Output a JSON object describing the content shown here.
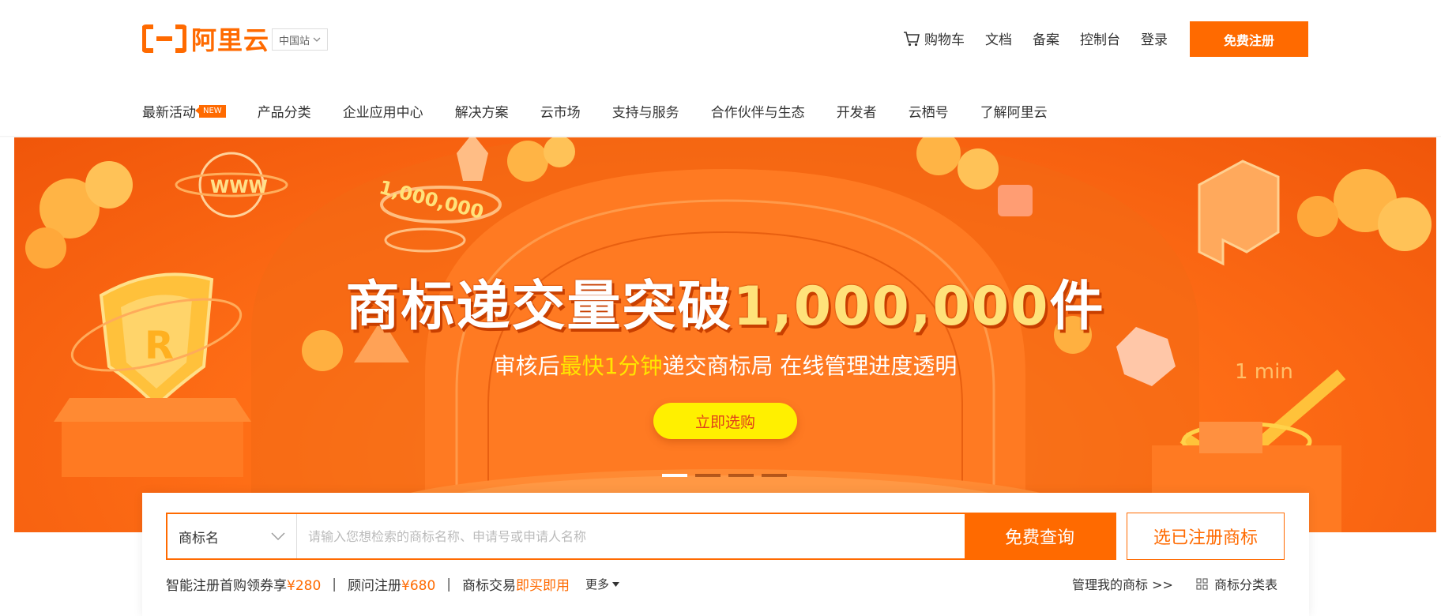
{
  "brand": {
    "logo_text": "阿里云",
    "color": "#ff6a00"
  },
  "header": {
    "site_selector": "中国站",
    "nav": {
      "cart": "购物车",
      "docs": "文档",
      "filing": "备案",
      "console": "控制台",
      "login": "登录"
    },
    "register_button": "免费注册"
  },
  "main_nav": {
    "items": [
      {
        "label": "最新活动",
        "badge": "NEW"
      },
      {
        "label": "产品分类"
      },
      {
        "label": "企业应用中心"
      },
      {
        "label": "解决方案"
      },
      {
        "label": "云市场"
      },
      {
        "label": "支持与服务"
      },
      {
        "label": "合作伙伴与生态"
      },
      {
        "label": "开发者"
      },
      {
        "label": "云栖号"
      },
      {
        "label": "了解阿里云"
      }
    ]
  },
  "banner": {
    "title_prefix": "商标递交量突破",
    "title_highlight": "1,000,000",
    "title_suffix": "件",
    "subtitle_pre": "审核后",
    "subtitle_highlight": "最快1分钟",
    "subtitle_post": "递交商标局 在线管理进度透明",
    "cta": "立即选购",
    "decor_text_million": "1,000,000",
    "decor_text_www": "WWW",
    "decor_text_r": "R",
    "decor_text_min": "1 min",
    "slide_count": 4,
    "active_slide": 1
  },
  "search": {
    "type_selected": "商标名",
    "placeholder": "请输入您想检索的商标名称、申请号或申请人名称",
    "value": "",
    "search_button": "免费查询",
    "select_button": "选已注册商标"
  },
  "promos": {
    "p1_label": "智能注册首购领券享",
    "p1_price": "¥280",
    "sep1": "|",
    "p2_label": "顾问注册",
    "p2_price": "¥680",
    "sep2": "|",
    "p3_label": "商标交易",
    "p3_highlight": "即买即用",
    "more": "更多"
  },
  "links": {
    "manage": "管理我的商标 >>",
    "category": "商标分类表"
  }
}
